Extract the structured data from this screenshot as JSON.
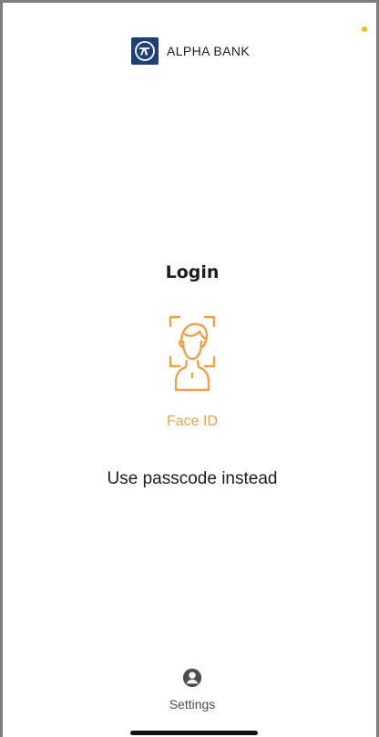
{
  "brand": {
    "name": "ALPHA BANK",
    "logo_icon": "alpha-bank-logo-icon",
    "accent_color": "#1f3f79"
  },
  "login": {
    "title": "Login",
    "face_id_label": "Face ID",
    "face_id_icon": "face-id-icon",
    "accent_color": "#f0a047",
    "alternate_action": "Use passcode instead"
  },
  "settings": {
    "label": "Settings",
    "icon": "user-circle-icon"
  },
  "status_bar": {
    "indicator_color": "#f2c200"
  }
}
